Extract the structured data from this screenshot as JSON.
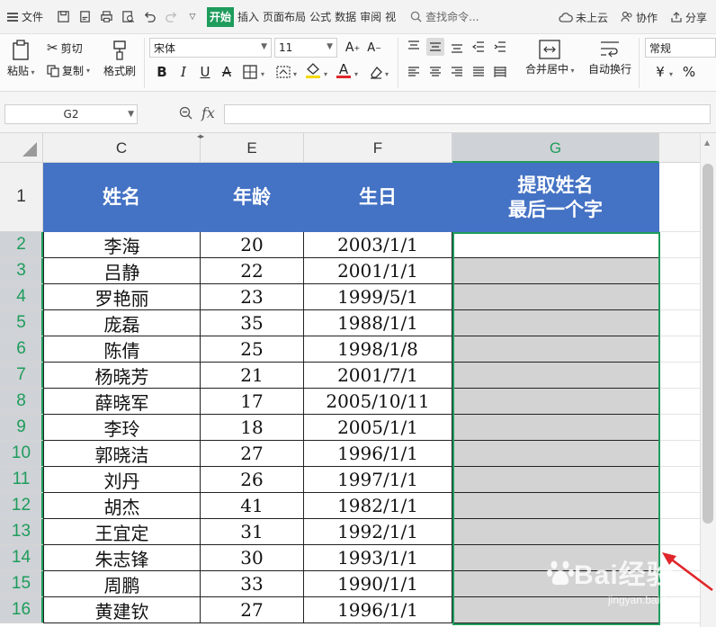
{
  "menubar": {
    "file_label": "文件",
    "tabs": [
      "开始",
      "插入",
      "页面布局",
      "公式",
      "数据",
      "审阅",
      "视"
    ],
    "active_tab": "开始",
    "search_label": "查找命令...",
    "cloud_label": "未上云",
    "collab_label": "协作",
    "share_label": "分享"
  },
  "ribbon": {
    "paste_label": "粘贴",
    "cut_label": "剪切",
    "copy_label": "复制",
    "format_painter_label": "格式刷",
    "font_name": "宋体",
    "font_size": "11",
    "merge_center_label": "合并居中",
    "wrap_label": "自动换行",
    "number_format": "常规",
    "currency_symbol": "¥",
    "percent_symbol": "%"
  },
  "formula_bar": {
    "name_box": "G2",
    "fx_label": "fx",
    "formula": ""
  },
  "sheet": {
    "columns": [
      "C",
      "E",
      "F",
      "G"
    ],
    "header_row_number": "1",
    "headers": {
      "name": "姓名",
      "age": "年龄",
      "birthday": "生日",
      "extract_line1": "提取姓名",
      "extract_line2": "最后一个字"
    },
    "rows": [
      {
        "row": "2",
        "name": "李海",
        "age": "20",
        "birthday": "2003/1/1"
      },
      {
        "row": "3",
        "name": "吕静",
        "age": "22",
        "birthday": "2001/1/1"
      },
      {
        "row": "4",
        "name": "罗艳丽",
        "age": "23",
        "birthday": "1999/5/1"
      },
      {
        "row": "5",
        "name": "庞磊",
        "age": "35",
        "birthday": "1988/1/1"
      },
      {
        "row": "6",
        "name": "陈倩",
        "age": "25",
        "birthday": "1998/1/8"
      },
      {
        "row": "7",
        "name": "杨晓芳",
        "age": "21",
        "birthday": "2001/7/1"
      },
      {
        "row": "8",
        "name": "薛晓军",
        "age": "17",
        "birthday": "2005/10/11"
      },
      {
        "row": "9",
        "name": "李玲",
        "age": "18",
        "birthday": "2005/1/1"
      },
      {
        "row": "10",
        "name": "郭晓洁",
        "age": "27",
        "birthday": "1996/1/1"
      },
      {
        "row": "11",
        "name": "刘丹",
        "age": "26",
        "birthday": "1997/1/1"
      },
      {
        "row": "12",
        "name": "胡杰",
        "age": "41",
        "birthday": "1982/1/1"
      },
      {
        "row": "13",
        "name": "王宜定",
        "age": "31",
        "birthday": "1992/1/1"
      },
      {
        "row": "14",
        "name": "朱志锋",
        "age": "30",
        "birthday": "1993/1/1"
      },
      {
        "row": "15",
        "name": "周鹏",
        "age": "33",
        "birthday": "1990/1/1"
      },
      {
        "row": "16",
        "name": "黄建钦",
        "age": "27",
        "birthday": "1996/1/1"
      }
    ]
  },
  "watermark": {
    "brand": "Bai经验",
    "url": "jingyan.baidu.com"
  },
  "colors": {
    "accent": "#1e9c5c",
    "header_fill": "#4472c4",
    "selection_fill": "#d3d3d3",
    "arrow": "#e0262a"
  }
}
